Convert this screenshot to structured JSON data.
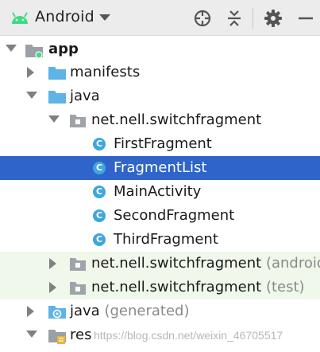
{
  "toolbar": {
    "view_name": "Android",
    "colors": {
      "android_green": "#3ddc84",
      "bg": "#ececec"
    },
    "buttons": [
      "crosshair-icon",
      "collapse-all-icon",
      "gear-icon",
      "minimize-icon"
    ]
  },
  "tree": {
    "app": "app",
    "manifests": "manifests",
    "java": "java",
    "package_main": "net.nell.switchfragment",
    "classes": {
      "c1": "FirstFragment",
      "c2": "FragmentList",
      "c3": "MainActivity",
      "c4": "SecondFragment",
      "c5": "ThirdFragment"
    },
    "package_android_test": "net.nell.switchfragment",
    "package_android_test_suffix": "(androidT",
    "package_test": "net.nell.switchfragment",
    "package_test_suffix": "(test)",
    "java_generated": "java",
    "java_generated_suffix": "(generated)",
    "res": "res",
    "class_badge": "C",
    "selected_item": "FragmentList",
    "selection_color": "#2f65ca"
  },
  "watermark": "https://blog.csdn.net/weixin_46705517"
}
